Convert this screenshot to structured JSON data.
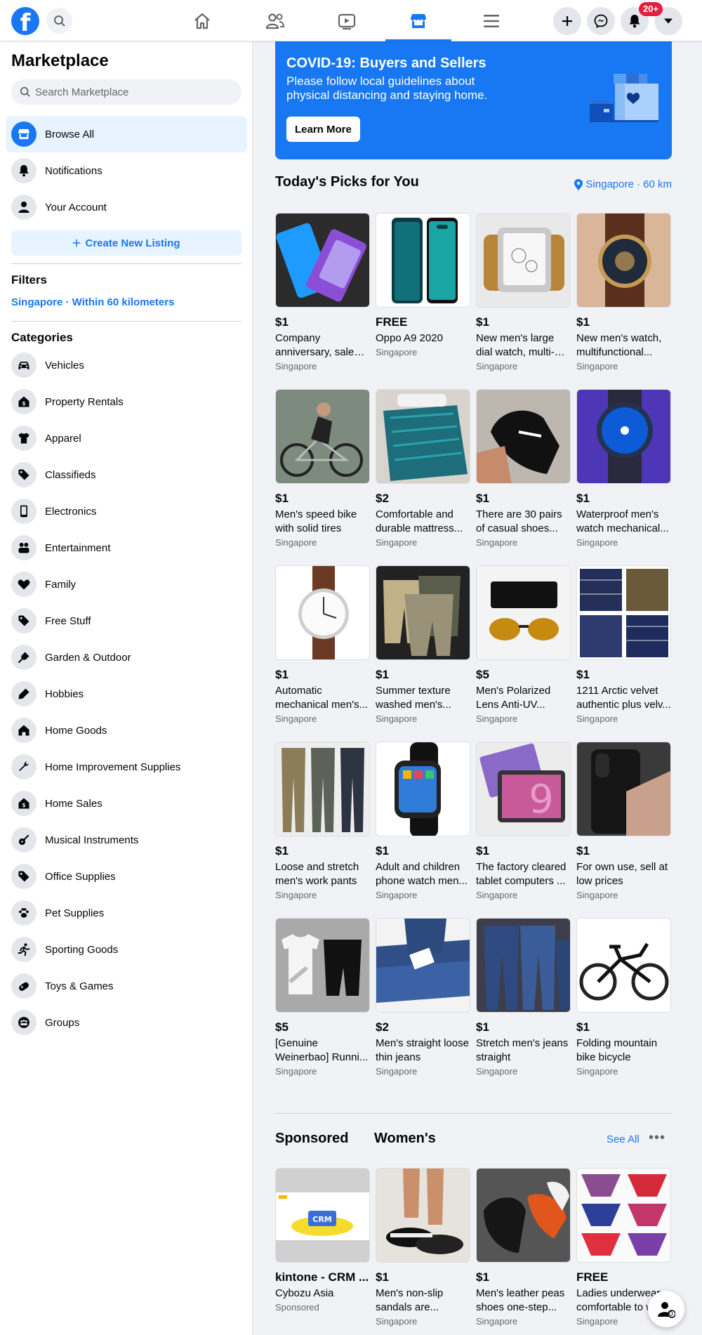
{
  "header": {
    "logo": "f",
    "notifications_badge": "20+",
    "nav_tabs": [
      "home-icon",
      "friends-icon",
      "watch-icon",
      "marketplace-icon",
      "menu-icon"
    ],
    "actions": [
      "plus-icon",
      "messenger-icon",
      "bell-icon",
      "caret-down-icon"
    ],
    "accent_color": "#1877f2"
  },
  "sidebar": {
    "title": "Marketplace",
    "search_placeholder": "Search Marketplace",
    "nav": [
      {
        "label": "Browse All",
        "icon": "storefront-icon"
      },
      {
        "label": "Notifications",
        "icon": "bell-icon"
      },
      {
        "label": "Your Account",
        "icon": "person-icon"
      }
    ],
    "create_listing": "Create New Listing",
    "filters_heading": "Filters",
    "filters_value": "Singapore · Within 60 kilometers",
    "categories_heading": "Categories",
    "categories": [
      {
        "label": "Vehicles",
        "icon": "car-icon"
      },
      {
        "label": "Property Rentals",
        "icon": "house-dollar-icon"
      },
      {
        "label": "Apparel",
        "icon": "shirt-icon"
      },
      {
        "label": "Classifieds",
        "icon": "tag-icon"
      },
      {
        "label": "Electronics",
        "icon": "phone-icon"
      },
      {
        "label": "Entertainment",
        "icon": "people-icon"
      },
      {
        "label": "Family",
        "icon": "heart-icon"
      },
      {
        "label": "Free Stuff",
        "icon": "tag-icon"
      },
      {
        "label": "Garden & Outdoor",
        "icon": "shovel-icon"
      },
      {
        "label": "Hobbies",
        "icon": "pencil-icon"
      },
      {
        "label": "Home Goods",
        "icon": "home-icon"
      },
      {
        "label": "Home Improvement Supplies",
        "icon": "wrench-icon"
      },
      {
        "label": "Home Sales",
        "icon": "house-dollar-icon"
      },
      {
        "label": "Musical Instruments",
        "icon": "guitar-icon"
      },
      {
        "label": "Office Supplies",
        "icon": "tag-icon"
      },
      {
        "label": "Pet Supplies",
        "icon": "paw-icon"
      },
      {
        "label": "Sporting Goods",
        "icon": "runner-icon"
      },
      {
        "label": "Toys & Games",
        "icon": "gamepad-icon"
      },
      {
        "label": "Groups",
        "icon": "groups-icon"
      }
    ]
  },
  "banner": {
    "title": "COVID-19: Buyers and Sellers",
    "text": "Please follow local guidelines about physical distancing and staying home.",
    "button": "Learn More"
  },
  "picks": {
    "title": "Today's Picks for You",
    "location": "Singapore · 60 km",
    "items": [
      {
        "price": "$1",
        "title": "Company anniversary, sale o...",
        "location": "Singapore",
        "img": "phones"
      },
      {
        "price": "FREE",
        "title": "Oppo A9 2020",
        "location": "Singapore",
        "img": "oppo"
      },
      {
        "price": "$1",
        "title": "New men's large dial watch, multi-functi...",
        "location": "Singapore",
        "img": "square-watch"
      },
      {
        "price": "$1",
        "title": "New men's watch, multifunctional...",
        "location": "Singapore",
        "img": "wrist-watch"
      },
      {
        "price": "$1",
        "title": "Men's speed bike with solid tires",
        "location": "Singapore",
        "img": "bike-rider"
      },
      {
        "price": "$2",
        "title": "Comfortable and durable mattress...",
        "location": "Singapore",
        "img": "mattress"
      },
      {
        "price": "$1",
        "title": "There are 30 pairs of casual shoes...",
        "location": "Singapore",
        "img": "sneaker"
      },
      {
        "price": "$1",
        "title": "Waterproof men's watch mechanical...",
        "location": "Singapore",
        "img": "blue-watch"
      },
      {
        "price": "$1",
        "title": "Automatic mechanical men's...",
        "location": "Singapore",
        "img": "white-watch"
      },
      {
        "price": "$1",
        "title": "Summer texture washed men's...",
        "location": "Singapore",
        "img": "shorts"
      },
      {
        "price": "$5",
        "title": "Men's Polarized Lens Anti-UV...",
        "location": "Singapore",
        "img": "sunglasses"
      },
      {
        "price": "$1",
        "title": "1211 Arctic velvet authentic plus velv...",
        "location": "Singapore",
        "img": "shirts"
      },
      {
        "price": "$1",
        "title": "Loose and stretch men's work pants",
        "location": "Singapore",
        "img": "pants"
      },
      {
        "price": "$1",
        "title": "Adult and children phone watch men...",
        "location": "Singapore",
        "img": "smartwatch"
      },
      {
        "price": "$1",
        "title": "The factory cleared tablet computers ...",
        "location": "Singapore",
        "img": "tablets"
      },
      {
        "price": "$1",
        "title": "For own use, sell at low prices",
        "location": "Singapore",
        "img": "iphone"
      },
      {
        "price": "$5",
        "title": "[Genuine Weinerbao] Runni...",
        "location": "Singapore",
        "img": "tshirt-set"
      },
      {
        "price": "$2",
        "title": "Men's straight loose thin jeans",
        "location": "Singapore",
        "img": "jeans-stack"
      },
      {
        "price": "$1",
        "title": "Stretch men's jeans straight",
        "location": "Singapore",
        "img": "jeans-hanging"
      },
      {
        "price": "$1",
        "title": "Folding mountain bike bicycle",
        "location": "Singapore",
        "img": "folding-bike"
      }
    ]
  },
  "sponsored": {
    "heading": "Sponsored",
    "category_heading": "Women's",
    "see_all": "See All",
    "more": "•••",
    "items": [
      {
        "price": "kintone - CRM ...",
        "title": "Cybozu Asia",
        "location": "Sponsored",
        "img": "crm-ad"
      },
      {
        "price": "$1",
        "title": "Men's non-slip sandals are...",
        "location": "Singapore",
        "img": "sandals"
      },
      {
        "price": "$1",
        "title": "Men's leather peas shoes one-step...",
        "location": "Singapore",
        "img": "loafers"
      },
      {
        "price": "FREE",
        "title": "Ladies underwear comfortable to w...",
        "location": "Singapore",
        "img": "underwear"
      }
    ]
  },
  "chat": {
    "count": "0"
  }
}
